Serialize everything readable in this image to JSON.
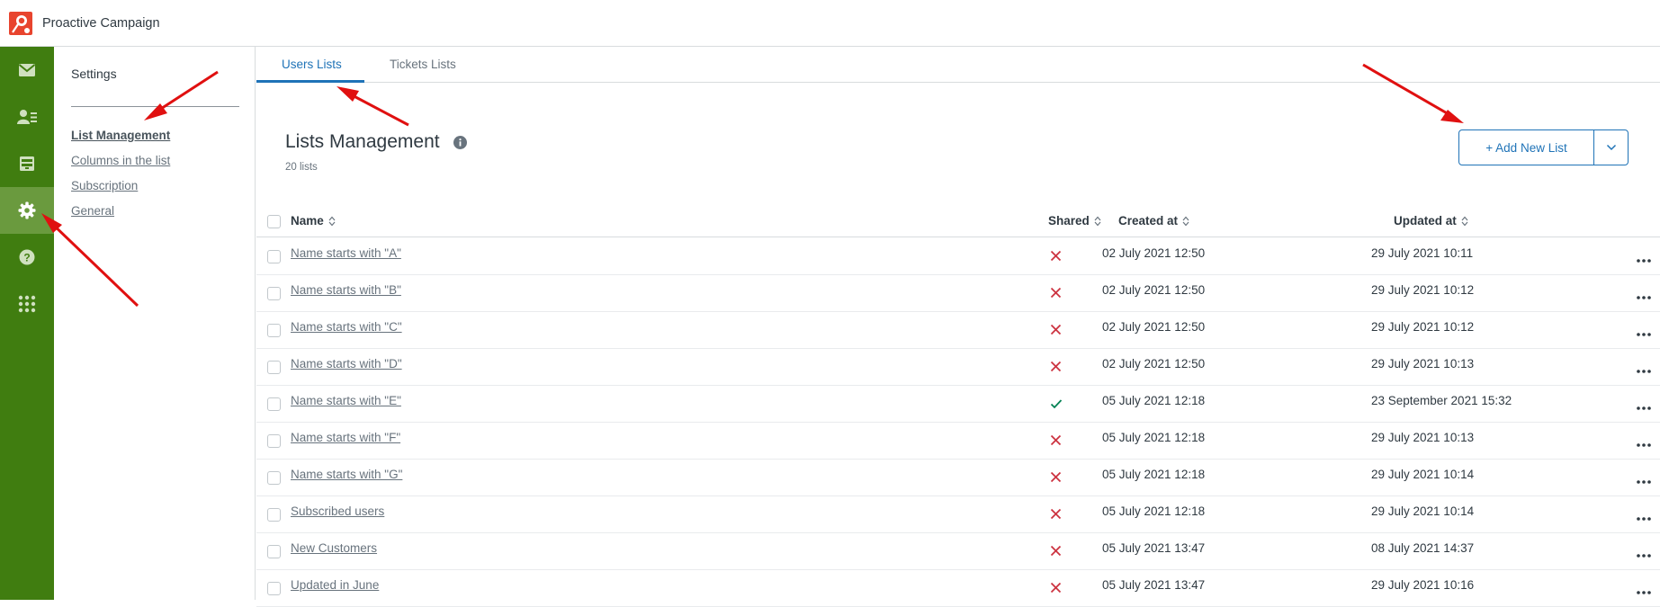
{
  "app": {
    "title": "Proactive Campaign"
  },
  "rail": {
    "items": [
      {
        "icon": "mail-icon"
      },
      {
        "icon": "contacts-icon"
      },
      {
        "icon": "archive-icon"
      },
      {
        "icon": "gear-icon",
        "active": true
      },
      {
        "icon": "help-icon"
      },
      {
        "icon": "apps-grid-icon"
      }
    ]
  },
  "sidebar": {
    "title": "Settings",
    "links": [
      {
        "label": "List Management",
        "current": true
      },
      {
        "label": "Columns in the list"
      },
      {
        "label": "Subscription"
      },
      {
        "label": "General"
      }
    ]
  },
  "tabs": [
    {
      "label": "Users Lists",
      "active": true
    },
    {
      "label": "Tickets Lists"
    }
  ],
  "page": {
    "title": "Lists Management",
    "count": "20 lists",
    "add_button": "+ Add New List"
  },
  "table": {
    "columns": {
      "name": "Name",
      "shared": "Shared",
      "created": "Created at",
      "updated": "Updated at"
    },
    "rows": [
      {
        "name": "Name starts with \"A\"",
        "shared": false,
        "created": "02 July 2021 12:50",
        "updated": "29 July 2021 10:11"
      },
      {
        "name": "Name starts with \"B\"",
        "shared": false,
        "created": "02 July 2021 12:50",
        "updated": "29 July 2021 10:12"
      },
      {
        "name": "Name starts with \"C\"",
        "shared": false,
        "created": "02 July 2021 12:50",
        "updated": "29 July 2021 10:12"
      },
      {
        "name": "Name starts with \"D\"",
        "shared": false,
        "created": "02 July 2021 12:50",
        "updated": "29 July 2021 10:13"
      },
      {
        "name": "Name starts with \"E\"",
        "shared": true,
        "created": "05 July 2021 12:18",
        "updated": "23 September 2021 15:32"
      },
      {
        "name": "Name starts with \"F\"",
        "shared": false,
        "created": "05 July 2021 12:18",
        "updated": "29 July 2021 10:13"
      },
      {
        "name": "Name starts with \"G\"",
        "shared": false,
        "created": "05 July 2021 12:18",
        "updated": "29 July 2021 10:14"
      },
      {
        "name": "Subscribed users",
        "shared": false,
        "created": "05 July 2021 12:18",
        "updated": "29 July 2021 10:14"
      },
      {
        "name": "New Customers",
        "shared": false,
        "created": "05 July 2021 13:47",
        "updated": "08 July 2021 14:37"
      },
      {
        "name": "Updated in June",
        "shared": false,
        "created": "05 July 2021 13:47",
        "updated": "29 July 2021 10:16"
      }
    ]
  },
  "colors": {
    "rail": "#407d10",
    "rail_active": "#6a9a3e",
    "accent": "#1f73b7",
    "error": "#cc3340",
    "success": "#038153",
    "annotation": "#e01010"
  }
}
